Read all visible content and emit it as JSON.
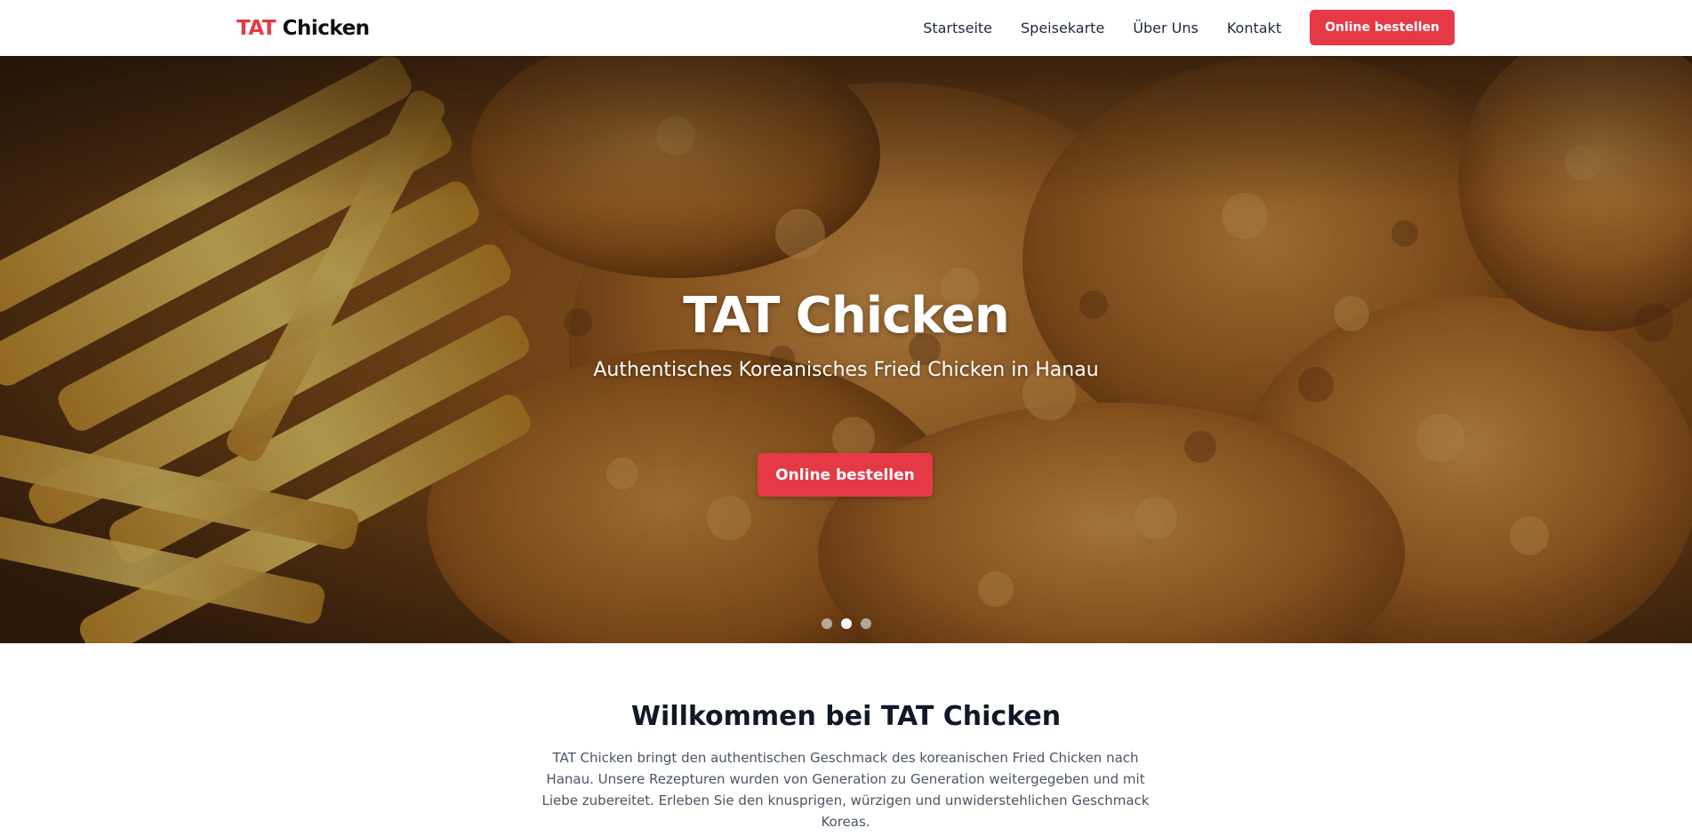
{
  "header": {
    "logo_accent": "TAT",
    "logo_main": " Chicken",
    "nav": {
      "home": "Startseite",
      "menu": "Speisekarte",
      "about": "Über Uns",
      "contact": "Kontakt"
    },
    "order_button": "Online bestellen"
  },
  "hero": {
    "title": "TAT Chicken",
    "subtitle": "Authentisches Koreanisches Fried Chicken in Hanau",
    "order_button": "Online bestellen",
    "slide_indicators": {
      "count": 3,
      "active_index": 1
    }
  },
  "welcome": {
    "title": "Willkommen bei TAT Chicken",
    "text": "TAT Chicken bringt den authentischen Geschmack des koreanischen Fried Chicken nach Hanau. Unsere Rezepturen wurden von Generation zu Generation weitergegeben und mit Liebe zubereitet. Erleben Sie den knusprigen, würzigen und unwiderstehlichen Geschmack Koreas."
  },
  "colors": {
    "accent": "#e63946",
    "heading": "#111827",
    "body_text": "#4b5563",
    "nav_text": "#1f2937"
  }
}
